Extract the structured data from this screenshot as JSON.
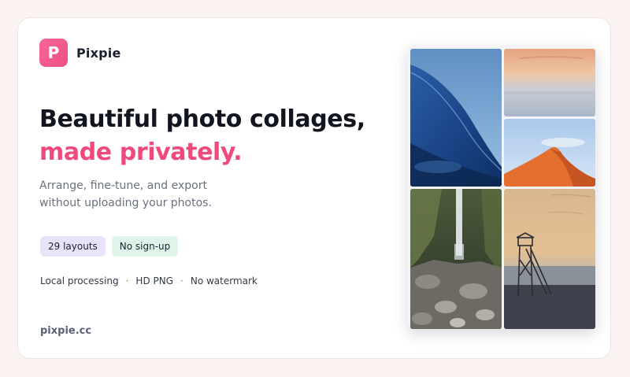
{
  "brand": {
    "logo_letter": "P",
    "name": "Pixpie",
    "accent_color": "#ef4a7b"
  },
  "hero": {
    "headline_line1": "Beautiful photo collages,",
    "headline_line2": "made privately.",
    "subtext_line1": "Arrange, fine-tune, and export",
    "subtext_line2": "without uploading your photos."
  },
  "badges": [
    {
      "label": "29 layouts",
      "color": "#e8e2fb"
    },
    {
      "label": "No sign-up",
      "color": "#dff5ea"
    }
  ],
  "features": {
    "items": [
      "Local processing",
      "HD PNG",
      "No watermark"
    ],
    "separator": "·"
  },
  "footer": {
    "domain": "pixpie.cc"
  },
  "collage": {
    "photos": [
      {
        "name": "ocean-wave-photo"
      },
      {
        "name": "misty-sunset-photo"
      },
      {
        "name": "orange-dune-photo"
      },
      {
        "name": "waterfall-gorge-photo"
      },
      {
        "name": "lifeguard-tower-photo"
      }
    ]
  }
}
